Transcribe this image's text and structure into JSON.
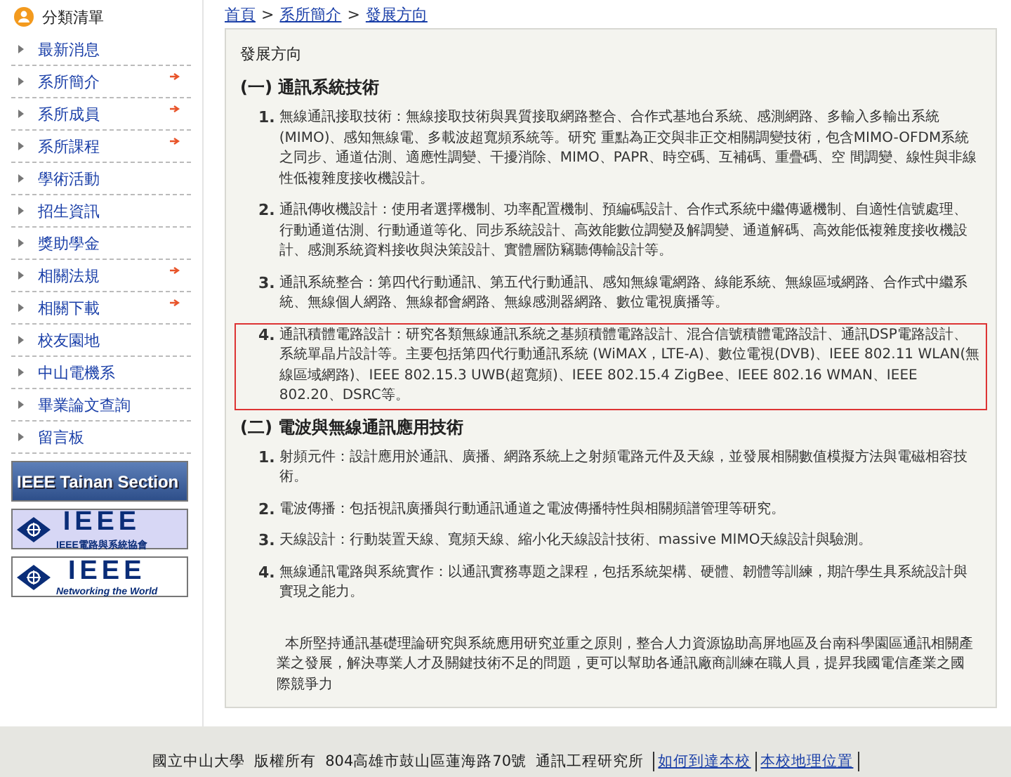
{
  "sidebar": {
    "title": "分類清單",
    "items": [
      {
        "label": "最新消息",
        "has_submenu": false
      },
      {
        "label": "系所簡介",
        "has_submenu": true
      },
      {
        "label": "系所成員",
        "has_submenu": true
      },
      {
        "label": "系所課程",
        "has_submenu": true
      },
      {
        "label": "學術活動",
        "has_submenu": false
      },
      {
        "label": "招生資訊",
        "has_submenu": false
      },
      {
        "label": "獎助學金",
        "has_submenu": false
      },
      {
        "label": "相關法規",
        "has_submenu": true
      },
      {
        "label": "相關下載",
        "has_submenu": true
      },
      {
        "label": "校友園地",
        "has_submenu": false
      },
      {
        "label": "中山電機系",
        "has_submenu": false
      },
      {
        "label": "畢業論文查詢",
        "has_submenu": false
      },
      {
        "label": "留言板",
        "has_submenu": false
      }
    ],
    "banners": [
      {
        "kind": "text",
        "title": "IEEE Tainan Section"
      },
      {
        "kind": "logo",
        "title": "IEEE",
        "subtitle": "IEEE電路與系統協會"
      },
      {
        "kind": "logo_plain",
        "title": "IEEE",
        "subtitle": "Networking the World"
      }
    ]
  },
  "breadcrumb": [
    "首頁",
    "系所簡介",
    "發展方向"
  ],
  "breadcrumb_separator": ">",
  "page_title": "發展方向",
  "sections": [
    {
      "heading": "(一) 通訊系統技術",
      "items": [
        {
          "number": "1.",
          "text": "無線通訊接取技術：無線接取技術與異質接取網路整合、合作式基地台系統、感測網路、多輸入多輸出系統(MIMO)、感知無線電、多載波超寬頻系統等。研究 重點為正交與非正交相關調變技術，包含MIMO-OFDM系統之同步、通道估測、適應性調變、干擾消除、MIMO、PAPR、時空碼、互補碼、重疊碼、空 間調變、線性與非線性低複雜度接收機設計。",
          "boxed": false
        },
        {
          "number": "2.",
          "text": "通訊傳收機設計：使用者選擇機制、功率配置機制、預編碼設計、合作式系統中繼傳遞機制、自適性信號處理、行動通道估測、行動通道等化、同步系統設計、高效能數位調變及解調變、通道解碼、高效能低複雜度接收機設計、感測系統資料接收與決策設計、實體層防竊聽傳輸設計等。",
          "boxed": false
        },
        {
          "number": "3.",
          "text": "通訊系統整合：第四代行動通訊、第五代行動通訊、感知無線電網路、綠能系統、無線區域網路、合作式中繼系統、無線個人網路、無線都會網路、無線感測器網路、數位電視廣播等。",
          "boxed": false
        },
        {
          "number": "4.",
          "text": "通訊積體電路設計：研究各類無線通訊系統之基頻積體電路設計、混合信號積體電路設計、通訊DSP電路設計、系統單晶片設計等。主要包括第四代行動通訊系統 (WiMAX，LTE-A)、數位電視(DVB)、IEEE 802.11 WLAN(無線區域網路)、IEEE 802.15.3 UWB(超寬頻)、IEEE 802.15.4 ZigBee、IEEE 802.16 WMAN、IEEE 802.20、DSRC等。",
          "boxed": true
        }
      ]
    },
    {
      "heading": "(二) 電波與無線通訊應用技術",
      "items": [
        {
          "number": "1.",
          "text": "射頻元件：設計應用於通訊、廣播、網路系統上之射頻電路元件及天線，並發展相關數值模擬方法與電磁相容技術。",
          "boxed": false
        },
        {
          "number": "2.",
          "text": "電波傳播：包括視訊廣播與行動通訊通道之電波傳播特性與相關頻譜管理等研究。",
          "boxed": false
        },
        {
          "number": "3.",
          "text": "天線設計：行動裝置天線、寬頻天線、縮小化天線設計技術、massive MIMO天線設計與驗測。",
          "boxed": false
        },
        {
          "number": "4.",
          "text": "無線通訊電路與系統實作：以通訊實務專題之課程，包括系統架構、硬體、韌體等訓練，期許學生具系統設計與實現之能力。",
          "boxed": false
        }
      ]
    }
  ],
  "closing": "本所堅持通訊基礎理論研究與系統應用研究並重之原則，整合人力資源協助高屏地區及台南科學園區通訊相關產業之發展，解決專業人才及關鍵技術不足的問題，更可以幫助各通訊廠商訓練在職人員，提昇我國電信產業之國際競爭力",
  "footer": {
    "text": "國立中山大學  版權所有  804高雄市鼓山區蓮海路70號  通訊工程研究所",
    "links": [
      "如何到達本校",
      "本校地理位置"
    ]
  }
}
